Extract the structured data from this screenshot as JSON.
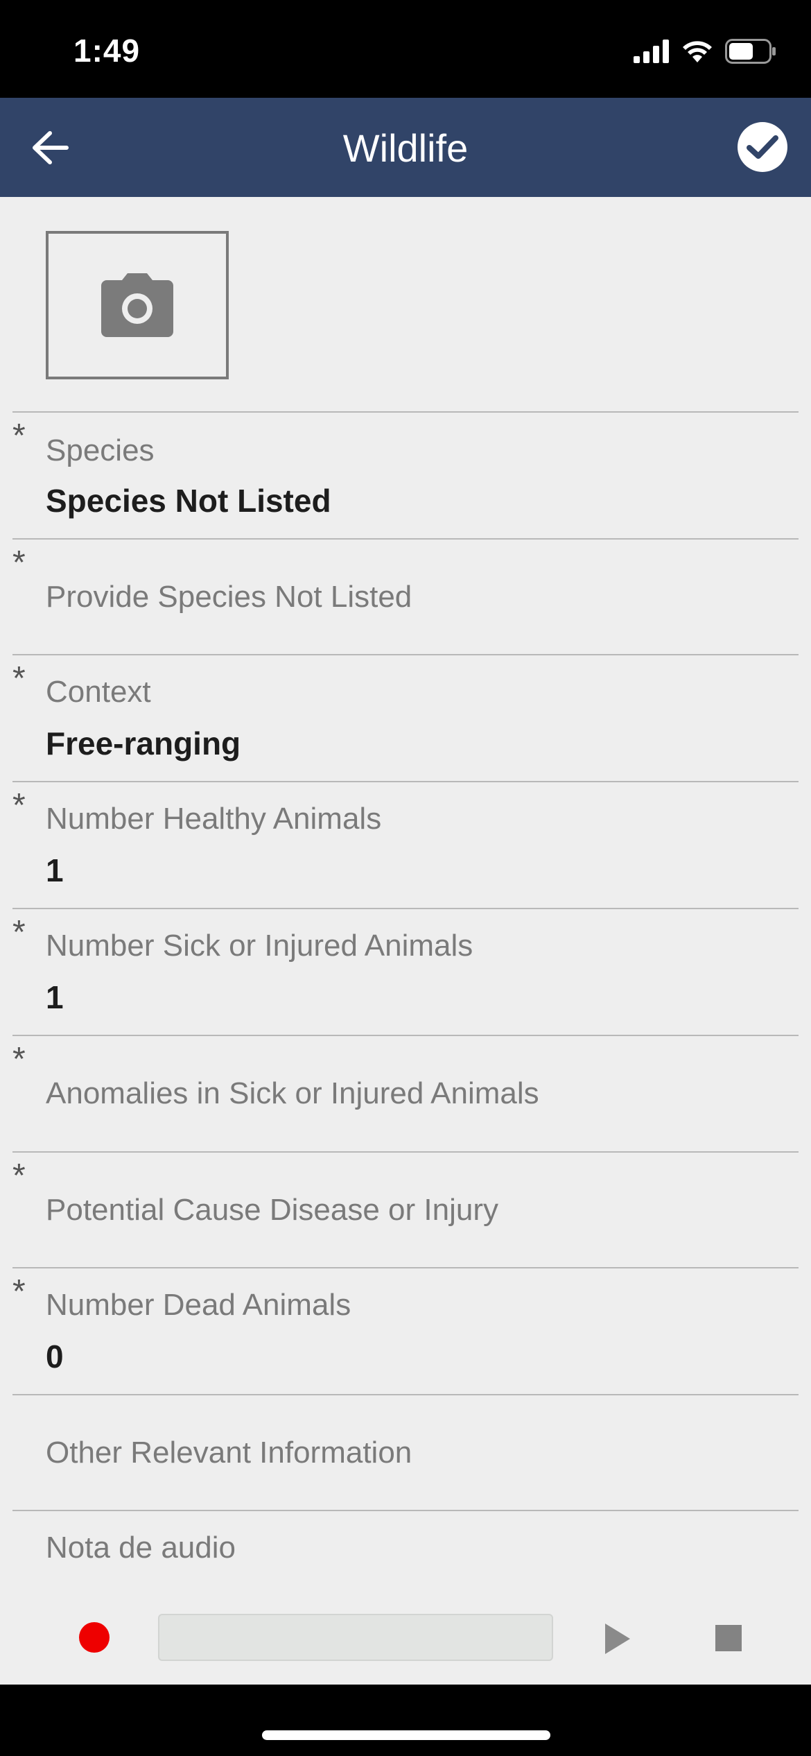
{
  "status_bar": {
    "time": "1:49",
    "icons": [
      "signal-icon",
      "wifi-icon",
      "battery-icon"
    ]
  },
  "nav": {
    "title": "Wildlife",
    "back_icon": "arrow-left-icon",
    "confirm_icon": "check-circle-icon",
    "bar_color": "#314468"
  },
  "photo": {
    "icon": "camera-icon"
  },
  "fields": [
    {
      "required": "*",
      "label": "Species",
      "value": "Species Not Listed"
    },
    {
      "required": "*",
      "label": "Provide Species Not Listed",
      "value": ""
    },
    {
      "required": "*",
      "label": "Context",
      "value": "Free-ranging"
    },
    {
      "required": "*",
      "label": "Number Healthy Animals",
      "value": "1"
    },
    {
      "required": "*",
      "label": "Number Sick or Injured Animals",
      "value": "1"
    },
    {
      "required": "*",
      "label": "Anomalies in Sick or Injured Animals",
      "value": ""
    },
    {
      "required": "*",
      "label": "Potential Cause Disease or Injury",
      "value": ""
    },
    {
      "required": "*",
      "label": "Number Dead Animals",
      "value": "0"
    },
    {
      "required": "",
      "label": "Other Relevant Information",
      "value": ""
    },
    {
      "required": "",
      "label": "Nota de audio",
      "value": ""
    }
  ],
  "audio": {
    "record_color": "#ee0000",
    "record_icon": "record-icon",
    "play_icon": "play-icon",
    "stop_icon": "stop-icon"
  }
}
